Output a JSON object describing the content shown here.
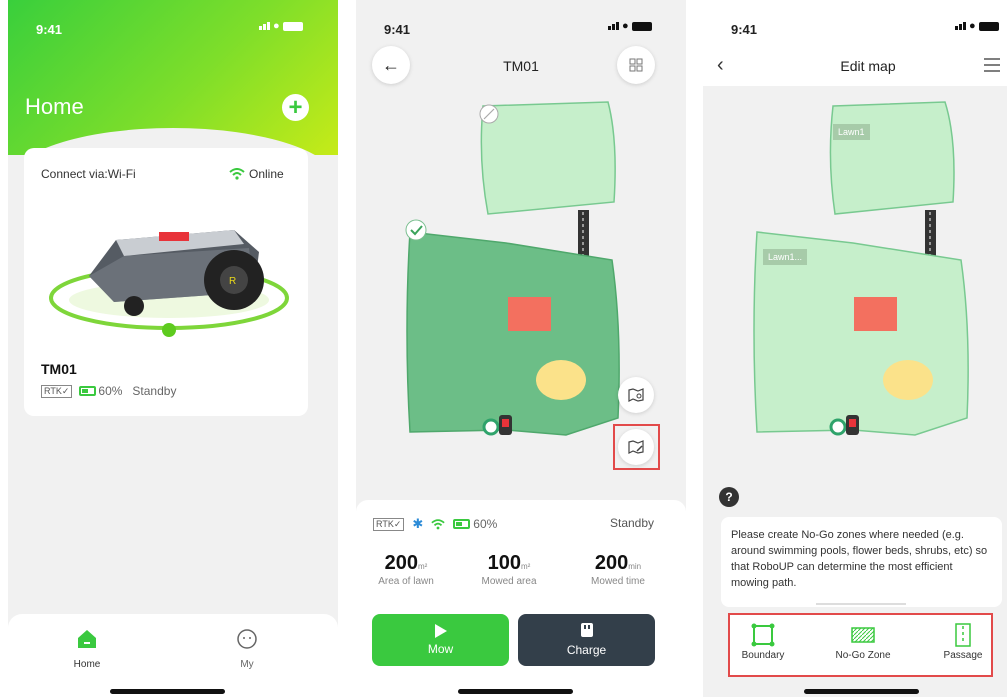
{
  "status_time": "9:41",
  "home": {
    "title": "Home",
    "connect_label": "Connect via:Wi-Fi",
    "online_label": "Online",
    "device_name": "TM01",
    "rtk_label": "RTK✓",
    "battery": "60%",
    "status": "Standby",
    "nav": [
      {
        "label": "Home"
      },
      {
        "label": "My"
      }
    ]
  },
  "device": {
    "title": "TM01",
    "rtk_label": "RTK✓",
    "battery": "60%",
    "status": "Standby",
    "stats": [
      {
        "value": "200",
        "unit": "m²",
        "label": "Area of lawn"
      },
      {
        "value": "100",
        "unit": "m²",
        "label": "Mowed area"
      },
      {
        "value": "200",
        "unit": "min",
        "label": "Mowed time"
      }
    ],
    "mow_label": "Mow",
    "charge_label": "Charge",
    "colors": {
      "lawn_selected": "#6cbe87",
      "lawn": "#c6efcb",
      "nogo": "#f3705f",
      "obstacle": "#fbe28a",
      "mow_button": "#3ac93f",
      "charge_button": "#333f4a"
    }
  },
  "edit_map": {
    "title": "Edit map",
    "lawn_labels": [
      "Lawn1",
      "Lawn1..."
    ],
    "help_symbol": "?",
    "tip": "Please create No-Go zones where needed (e.g. around swimming pools, flower beds, shrubs, etc) so that  RoboUP can determine the most efficient mowing path.",
    "tools": [
      {
        "label": "Boundary"
      },
      {
        "label": "No-Go Zone"
      },
      {
        "label": "Passage"
      }
    ]
  }
}
